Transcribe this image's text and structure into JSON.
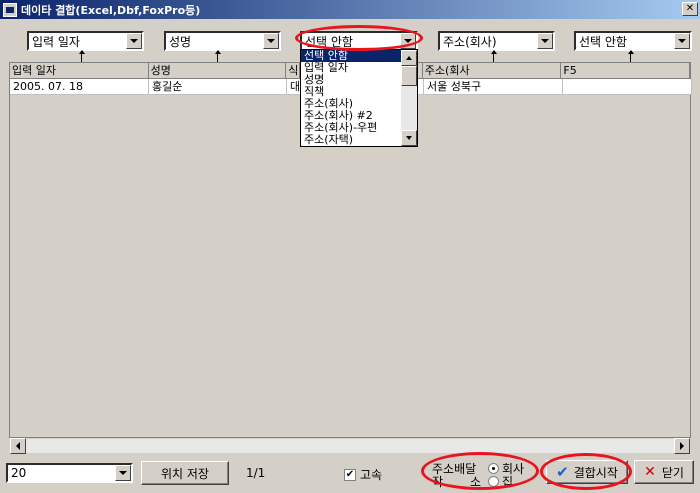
{
  "window": {
    "title": "데이타 결합(Excel,Dbf,FoxPro등)",
    "close_glyph": "✕"
  },
  "selectors": [
    {
      "value": "입력 일자"
    },
    {
      "value": "성명"
    },
    {
      "value": "선택 안함"
    },
    {
      "value": "주소(회사)"
    },
    {
      "value": "선택 안함"
    }
  ],
  "grid": {
    "columns": [
      "입력 일자",
      "성명",
      "식",
      "",
      "주소(회사",
      "F5"
    ],
    "rows": [
      [
        "2005. 07. 18",
        "홍길순",
        "대",
        "",
        "서울 성북구",
        ""
      ]
    ]
  },
  "dropdown": {
    "items": [
      "선택 안함",
      "입력 일자",
      "성명",
      "직책",
      "주소(회사)",
      "주소(회사) #2",
      "주소(회사)-우편",
      "주소(자택)"
    ],
    "selected_index": 0
  },
  "footer": {
    "page_size": "20",
    "save_position_label": "위치 저장",
    "page_indicator": "1/1",
    "fast_label": "고속",
    "fast_checked": true,
    "address_label_line1": "주소배달",
    "address_label_line2": "작",
    "address_label_line2b": "소",
    "radio_company": "회사",
    "radio_home": "집",
    "start_label": "결합시작",
    "close_label": "닫기"
  },
  "colors": {
    "highlight": "#e8141e",
    "selection": "#0a246a",
    "check_blue": "#1f5fbf",
    "close_red": "#d00000"
  }
}
